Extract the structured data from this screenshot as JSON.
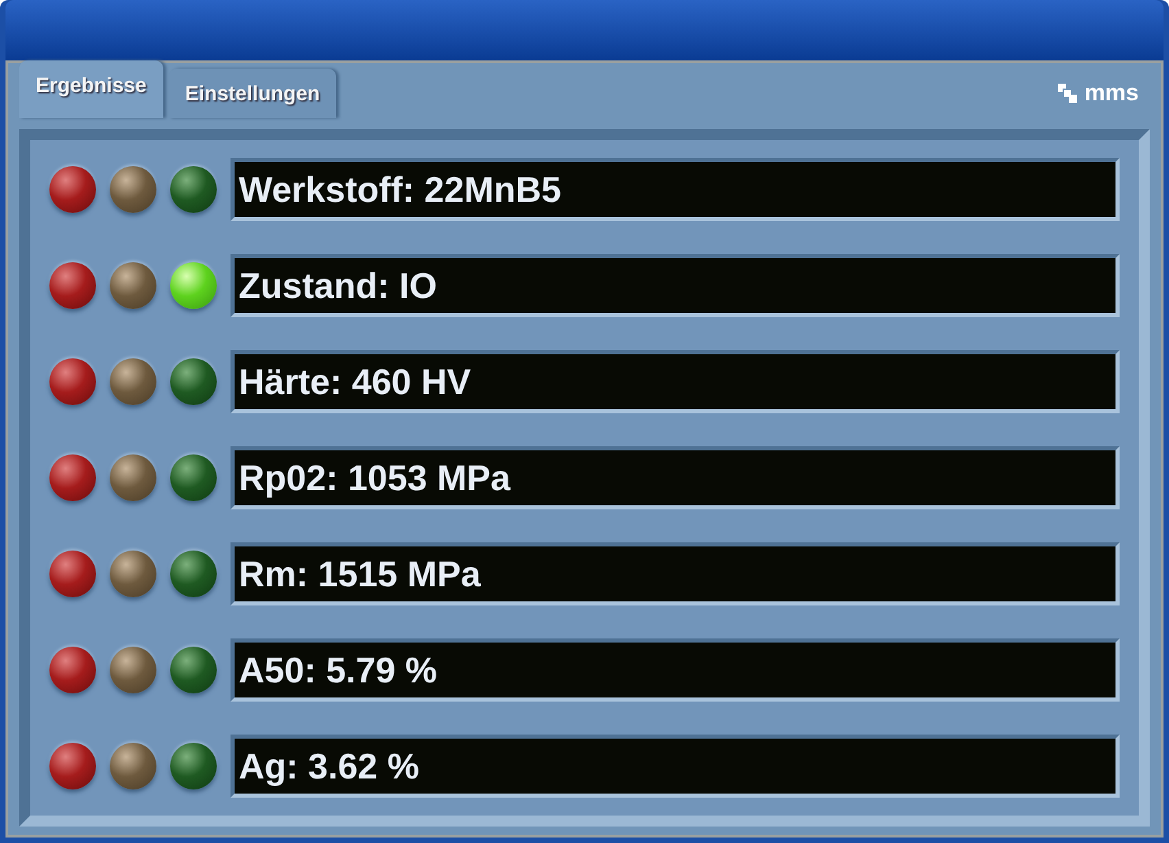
{
  "tabs": [
    {
      "label": "Ergebnisse",
      "selected": true
    },
    {
      "label": "Einstellungen",
      "selected": false
    }
  ],
  "brand": "mms",
  "rows": [
    {
      "text": "Werkstoff: 22MnB5",
      "lamps": [
        {
          "kind": "red",
          "on": false
        },
        {
          "kind": "amber",
          "on": false
        },
        {
          "kind": "green",
          "on": false
        }
      ]
    },
    {
      "text": "Zustand: IO",
      "lamps": [
        {
          "kind": "red",
          "on": false
        },
        {
          "kind": "amber",
          "on": false
        },
        {
          "kind": "green",
          "on": true
        }
      ]
    },
    {
      "text": "Härte: 460 HV",
      "lamps": [
        {
          "kind": "red",
          "on": false
        },
        {
          "kind": "amber",
          "on": false
        },
        {
          "kind": "green",
          "on": false
        }
      ]
    },
    {
      "text": "Rp02: 1053 MPa",
      "lamps": [
        {
          "kind": "red",
          "on": false
        },
        {
          "kind": "amber",
          "on": false
        },
        {
          "kind": "green",
          "on": false
        }
      ]
    },
    {
      "text": "Rm: 1515 MPa",
      "lamps": [
        {
          "kind": "red",
          "on": false
        },
        {
          "kind": "amber",
          "on": false
        },
        {
          "kind": "green",
          "on": false
        }
      ]
    },
    {
      "text": "A50: 5.79 %",
      "lamps": [
        {
          "kind": "red",
          "on": false
        },
        {
          "kind": "amber",
          "on": false
        },
        {
          "kind": "green",
          "on": false
        }
      ]
    },
    {
      "text": "Ag: 3.62 %",
      "lamps": [
        {
          "kind": "red",
          "on": false
        },
        {
          "kind": "amber",
          "on": false
        },
        {
          "kind": "green",
          "on": false
        }
      ]
    }
  ]
}
